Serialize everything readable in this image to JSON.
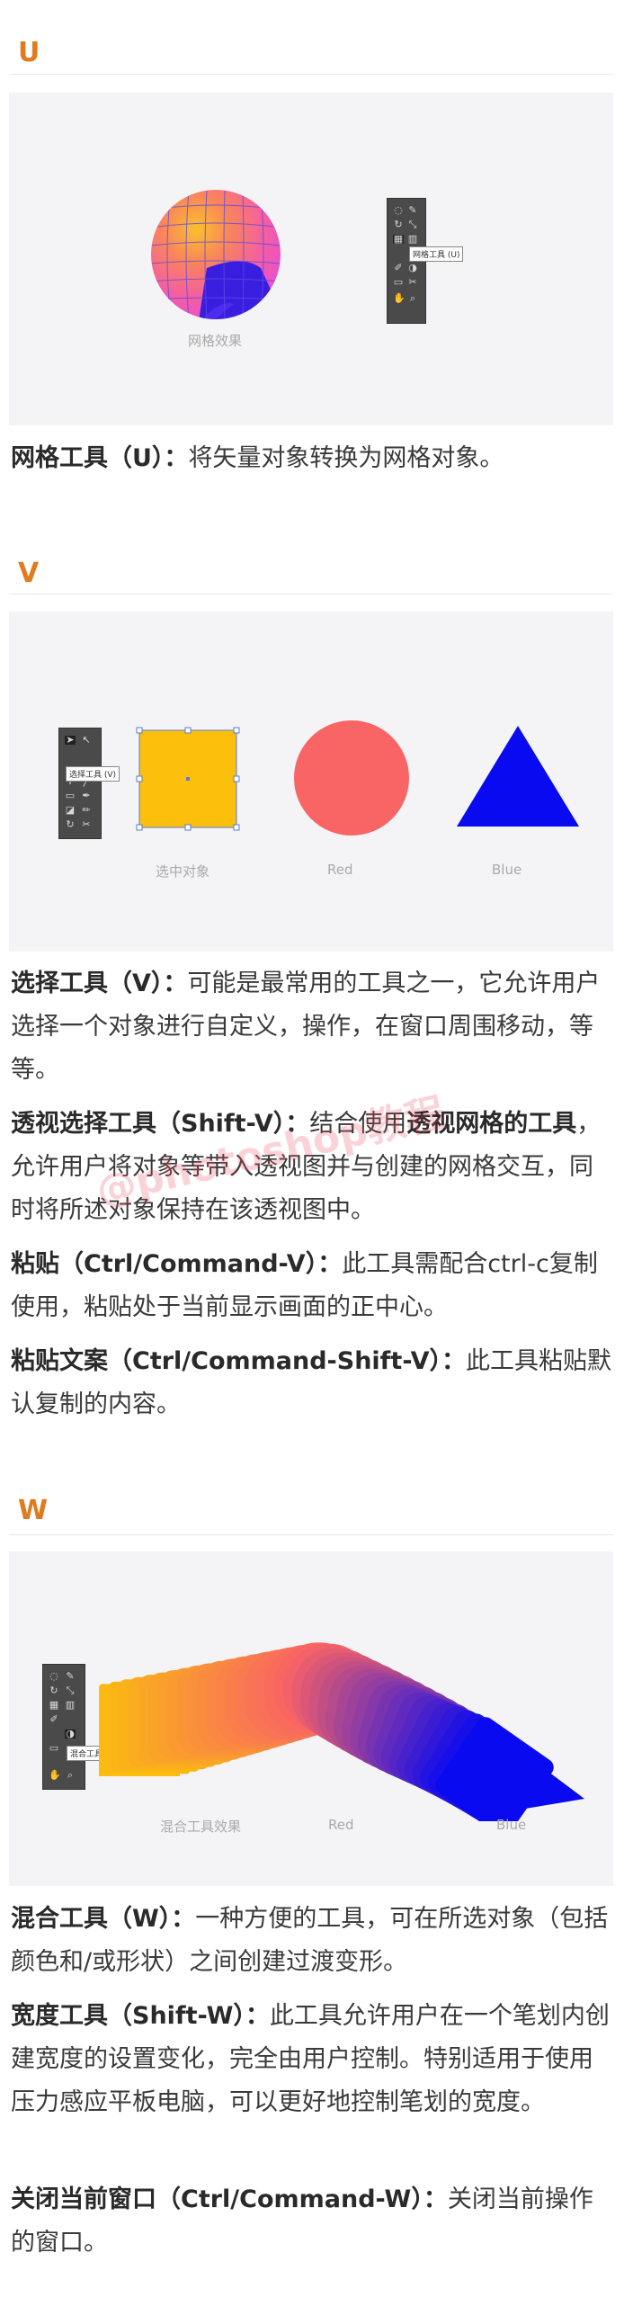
{
  "sections": {
    "u": {
      "letter": "U",
      "caption": "网格效果",
      "tooltip": "网格工具 (U)",
      "paragraphs": [
        {
          "term": "网格工具（U）：",
          "desc": "将矢量对象转换为网格对象。"
        }
      ]
    },
    "v": {
      "letter": "V",
      "tooltip": "选择工具 (V)",
      "captions": {
        "selected": "选中对象",
        "red": "Red",
        "blue": "Blue"
      },
      "paragraphs": [
        {
          "term": "选择工具（V）：",
          "desc": "可能是最常用的工具之一，它允许用户选择一个对象进行自定义，操作，在窗口周围移动，等等。"
        },
        {
          "term": "透视选择工具（Shift-V）：",
          "desc_a": "结合使用",
          "term_b": "透视网格的工具",
          "desc_b": "，允许用户将对象等带入透视图并与创建的网格交互，同时将所述对象保持在该透视图中。"
        },
        {
          "term": "粘贴（Ctrl/Command-V）：",
          "desc": "此工具需配合ctrl-c复制使用，粘贴处于当前显示画面的正中心。"
        },
        {
          "term": "粘贴文案（Ctrl/Command-Shift-V）：",
          "desc": "此工具粘贴默认复制的内容。"
        }
      ]
    },
    "w": {
      "letter": "W",
      "tooltip": "混合工具 (W)",
      "captions": {
        "blend": "混合工具效果",
        "red": "Red",
        "blue": "Blue"
      },
      "paragraphs": [
        {
          "term": "混合工具（W）：",
          "desc": "一种方便的工具，可在所选对象（包括颜色和/或形状）之间创建过渡变形。"
        },
        {
          "term": "宽度工具（Shift-W）：",
          "desc": "此工具允许用户在一个笔划内创建宽度的设置变化，完全由用户控制。特别适用于使用压力感应平板电脑，可以更好地控制笔划的宽度。"
        },
        {
          "term": "关闭当前窗口（Ctrl/Command-W）：",
          "desc": "关闭当前操作的窗口。"
        }
      ]
    }
  },
  "watermark": "@photoshop教程",
  "colors": {
    "accent": "#e07b1f",
    "panel": "#f4f4f6",
    "yellow": "#fbbf0c",
    "red": "#f96464",
    "blue": "#0a0af0",
    "toolbox": "#4a4a4a"
  }
}
